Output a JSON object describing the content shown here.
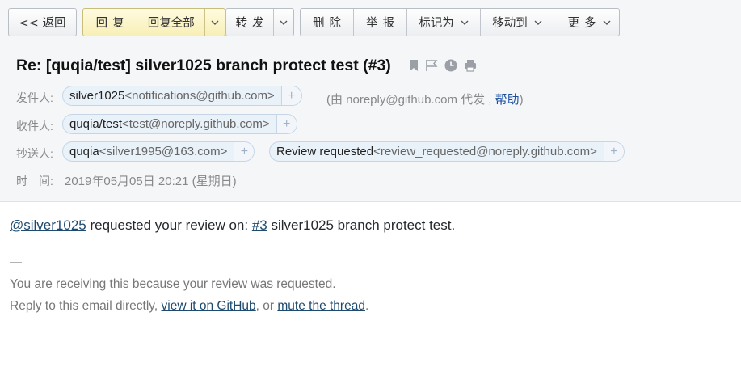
{
  "toolbar": {
    "back": "<< 返回",
    "reply": "回复",
    "reply_all": "回复全部",
    "forward": "转发",
    "delete": "删除",
    "report": "举报",
    "mark_as": "标记为",
    "move_to": "移动到",
    "more": "更多"
  },
  "subject": "Re: [quqia/test] silver1025 branch protect test (#3)",
  "from": {
    "label": "发件人:",
    "name": "silver1025",
    "address": "<notifications@github.com>",
    "via_prefix": "(由 noreply@github.com 代发 ,",
    "help": "帮助",
    "via_suffix": ")"
  },
  "to": {
    "label": "收件人:",
    "name": "quqia/test",
    "address": "<test@noreply.github.com>"
  },
  "cc": {
    "label": "抄送人:",
    "recipients": [
      {
        "name": "quqia",
        "address": "<silver1995@163.com>"
      },
      {
        "name": "Review requested",
        "address": "<review_requested@noreply.github.com>"
      }
    ]
  },
  "time": {
    "label": "时　间:",
    "value": "2019年05月05日 20:21 (星期日)"
  },
  "body": {
    "mention": "@silver1025",
    "requested_text": " requested your review on: ",
    "pr_link": "#3",
    "pr_title": " silver1025 branch protect test.",
    "separator": "—",
    "reason": "You are receiving this because your review was requested.",
    "reply_prefix": "Reply to this email directly, ",
    "view_link": "view it on GitHub",
    "or_text": ", or ",
    "mute_link": "mute the thread",
    "period": "."
  }
}
